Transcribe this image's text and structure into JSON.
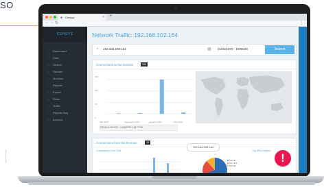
{
  "corner_text": "SO",
  "browser": {
    "tab_title": "Censys",
    "tab_close": "×",
    "new_tab": "+"
  },
  "app": {
    "logo": "CENSYS",
    "sidebar": [
      {
        "label": "Dashboard",
        "icon": "dashboard-icon"
      },
      {
        "label": "Data",
        "icon": "data-icon"
      },
      {
        "label": "Search",
        "icon": "search-icon"
      },
      {
        "label": "Devices",
        "icon": "devices-icon"
      },
      {
        "label": "Modules",
        "icon": "modules-icon"
      },
      {
        "label": "Reports",
        "icon": "reports-icon"
      },
      {
        "label": "Export",
        "icon": "export-icon"
      },
      {
        "label": "Rules",
        "icon": "rules-icon"
      },
      {
        "label": "Traffic",
        "icon": "traffic-icon"
      },
      {
        "label": "Reports Bug",
        "icon": "bug-icon"
      },
      {
        "label": "Account",
        "icon": "account-icon"
      }
    ],
    "title": "Network Traffic: 192.168.102.164",
    "search": {
      "value": "192.168.102.164",
      "date_range": "01/31/1970 - 10/06/20",
      "button": "Search"
    },
    "card1": {
      "title": "Connections to the Domain",
      "badge": "163",
      "y_ticks": [
        "150",
        "100",
        "50",
        "0"
      ],
      "x_ticks": [
        "May 2019",
        "September 2019",
        "January 2020",
        "May 2020"
      ],
      "footer": "FROM 01/31/1970 - 10/06/2020, 163 TOTAL"
    },
    "card2": {
      "title": "Connections from the Domain",
      "badge": "18",
      "sub_connections": "Connections Over Time",
      "sub_ports": "Ports",
      "sub_top": "Top URLs Visited",
      "ip_pill": "192.168.102.164",
      "legend": [
        "Port 80",
        "Port 443",
        "Port 53"
      ]
    },
    "alert_symbol": "!"
  },
  "chart_data": {
    "type": "bar",
    "categories": [
      "May 2019",
      "September 2019",
      "January 2020",
      "May 2020"
    ],
    "series": [
      {
        "values": [
          2,
          3,
          160,
          6
        ]
      }
    ],
    "ylim": [
      0,
      160
    ]
  },
  "colors": {
    "accent": "#4aa6df",
    "sidebar": "#252c33",
    "alert": "#e8174f",
    "bar": "#7cb5ec"
  }
}
